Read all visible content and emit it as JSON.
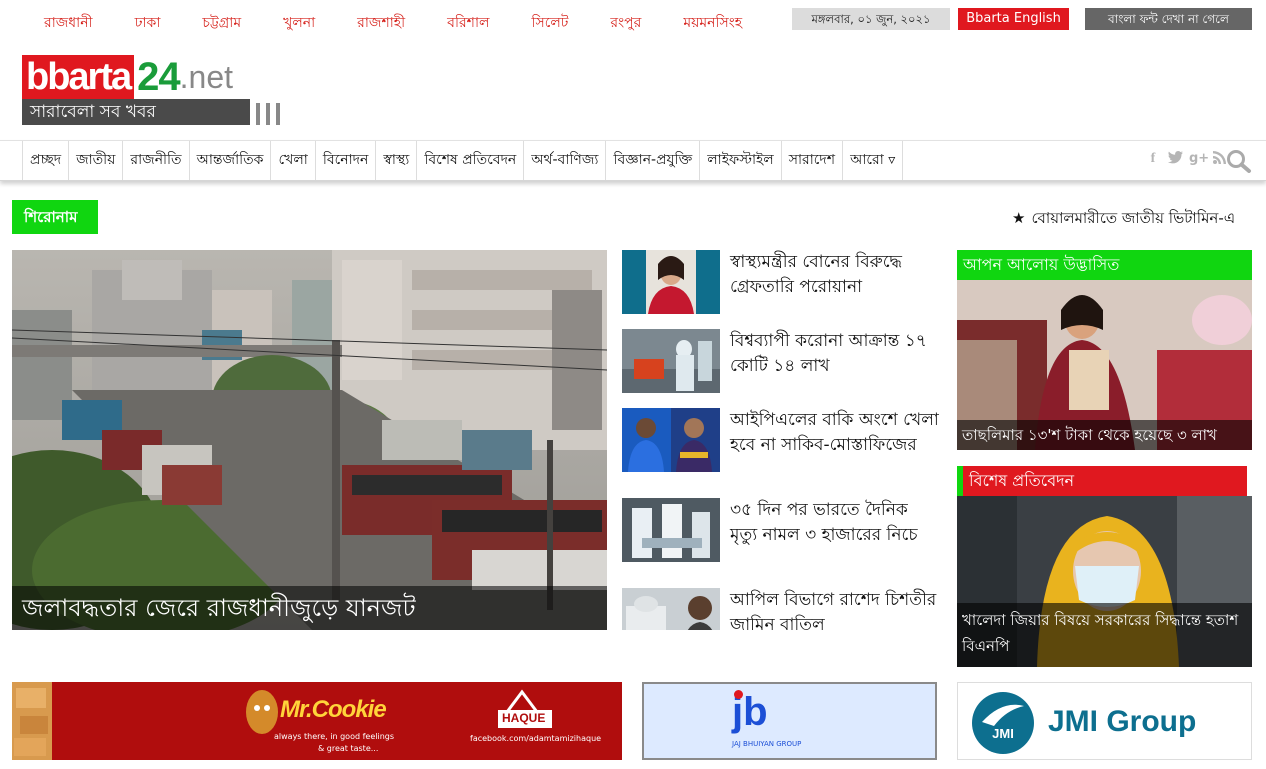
{
  "divisions": [
    "রাজধানী",
    "ঢাকা",
    "চট্টগ্রাম",
    "খুলনা",
    "রাজশাহী",
    "বরিশাল",
    "সিলেট",
    "রংপুর",
    "ময়মনসিংহ"
  ],
  "date_text": "মঙ্গলবার, ০১ জুন, ২০২১",
  "english_button": "Bbarta English",
  "font_button": "বাংলা ফন্ট দেখা না গেলে",
  "logo": {
    "part1": "bbarta",
    "part2": "24",
    "part3": ".net",
    "tagline": "সারাবেলা সব খবর"
  },
  "nav": [
    "প্রচ্ছদ",
    "জাতীয়",
    "রাজনীতি",
    "আন্তর্জাতিক",
    "খেলা",
    "বিনোদন",
    "স্বাস্থ্য",
    "বিশেষ প্রতিবেদন",
    "অর্থ-বাণিজ্য",
    "বিজ্ঞান-প্রযুক্তি",
    "লাইফস্টাইল",
    "সারাদেশ",
    "আরো ▿"
  ],
  "social_icons": [
    "facebook-icon",
    "twitter-icon",
    "google-plus-icon",
    "rss-icon"
  ],
  "ticker": {
    "label": "শিরোনাম",
    "text": "বোয়ালমারীতে জাতীয় ভিটামিন-এ"
  },
  "lead": {
    "caption": "জলাবদ্ধতার জেরে রাজধানীজুড়ে যানজট"
  },
  "news": [
    {
      "title": "স্বাস্থ্যমন্ত্রীর বোনের বিরুদ্ধে গ্রেফতারি পরোয়ানা"
    },
    {
      "title": "বিশ্বব্যাপী করোনা আক্রান্ত ১৭ কোটি ১৪ লাখ"
    },
    {
      "title": "আইপিএলের বাকি অংশে খেলা হবে না সাকিব-মোস্তাফিজের"
    },
    {
      "title": "৩৫ দিন পর ভারতে দৈনিক মৃত্যু নামল ৩ হাজারের নিচে"
    },
    {
      "title": "আপিল বিভাগে রাশেদ চিশতীর জামিন বাতিল"
    }
  ],
  "right_boxes": [
    {
      "header": "আপন আলোয় উদ্ভাসিত",
      "caption": "তাছলিমার ১৩'শ টাকা থেকে হয়েছে ৩ লাখ",
      "header_color": "#10d610"
    },
    {
      "header": "বিশেষ প্রতিবেদন",
      "caption": "খালেদা জিয়ার বিষয়ে সরকারের সিদ্ধান্তে হতাশ বিএনপি",
      "header_color": "#e0181f"
    }
  ],
  "ads": {
    "mrcookie": {
      "brand": "Mr.Cookie",
      "slogan1": "always there, in good feelings",
      "slogan2": "& great taste...",
      "haque": "HAQUE",
      "fb": "facebook.com/adamtamizihaque"
    },
    "jb": {
      "mark": "jb",
      "name": "JAJ BHUIYAN GROUP"
    },
    "jmi": {
      "badge": "JMI",
      "name": "JMI Group"
    }
  }
}
